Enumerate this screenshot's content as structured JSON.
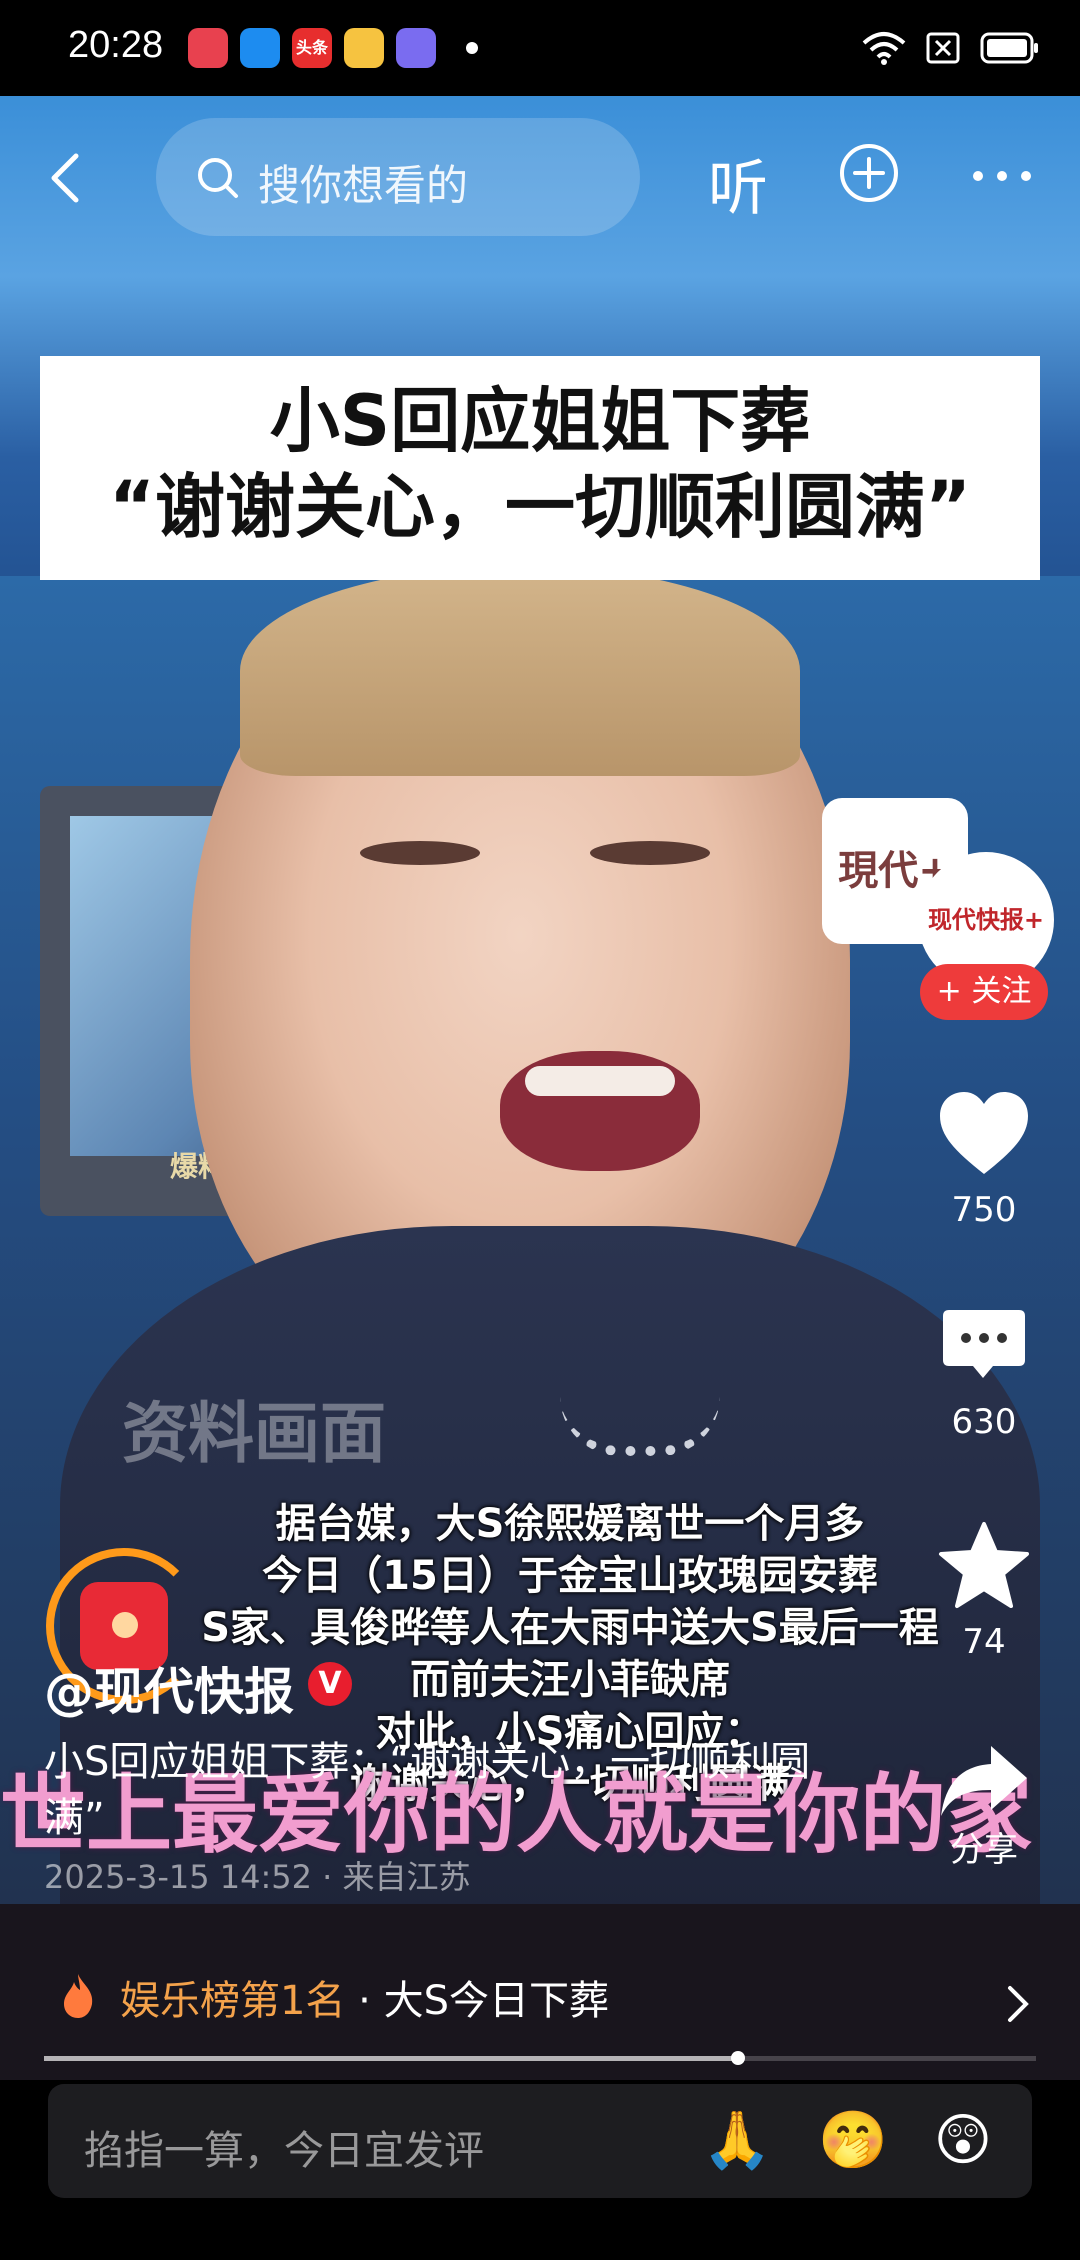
{
  "status_bar": {
    "time": "20:28",
    "app_icons": [
      {
        "name": "music-app-icon",
        "color": "#e8414f"
      },
      {
        "name": "browser-app-icon",
        "color": "#1d8cf0"
      },
      {
        "name": "toutiao-app-icon",
        "color": "#e72e2e",
        "text": "头条"
      },
      {
        "name": "notes-app-icon",
        "color": "#f6c340"
      },
      {
        "name": "store-app-icon",
        "color": "#7a6cf0"
      }
    ]
  },
  "top_nav": {
    "search_placeholder": "搜你想看的",
    "listen_label": "听"
  },
  "video": {
    "headline_line1": "小S回应姐姐下葬",
    "headline_line2": "“谢谢关心，一切顺利圆满”",
    "tv_label": "爆料热线 27047972",
    "watermark": "资料画面",
    "station_logo": "現代+",
    "subtitles": [
      "据台媒，大S徐熙媛离世一个月多",
      "今日（15日）于金宝山玫瑰园安葬",
      "S家、具俊晔等人在大雨中送大S最后一程",
      "而前夫汪小菲缺席",
      "对此，小S痛心回应：",
      "谢谢关心，一切顺利圆满"
    ],
    "bottom_banner": "世上最爱你的人就是你的家"
  },
  "right_rail": {
    "avatar_text": "现代快报+",
    "follow_label": "+ 关注",
    "like_count": "750",
    "comment_count": "630",
    "favorite_count": "74",
    "share_label": "分享"
  },
  "post": {
    "author": "@现代快报",
    "verified_badge": "V",
    "caption": "小S回应姐姐下葬：“谢谢关心，一切顺利圆满”",
    "meta": "2025-3-15 14:52 · 来自江苏"
  },
  "rank": {
    "label": "娱乐榜第1名",
    "separator": " · ",
    "topic": "大S今日下葬",
    "progress": 0.7
  },
  "comment_bar": {
    "placeholder": "掐指一算，今日宜发评",
    "emojis": [
      "🙏",
      "🤭",
      "😲"
    ]
  }
}
